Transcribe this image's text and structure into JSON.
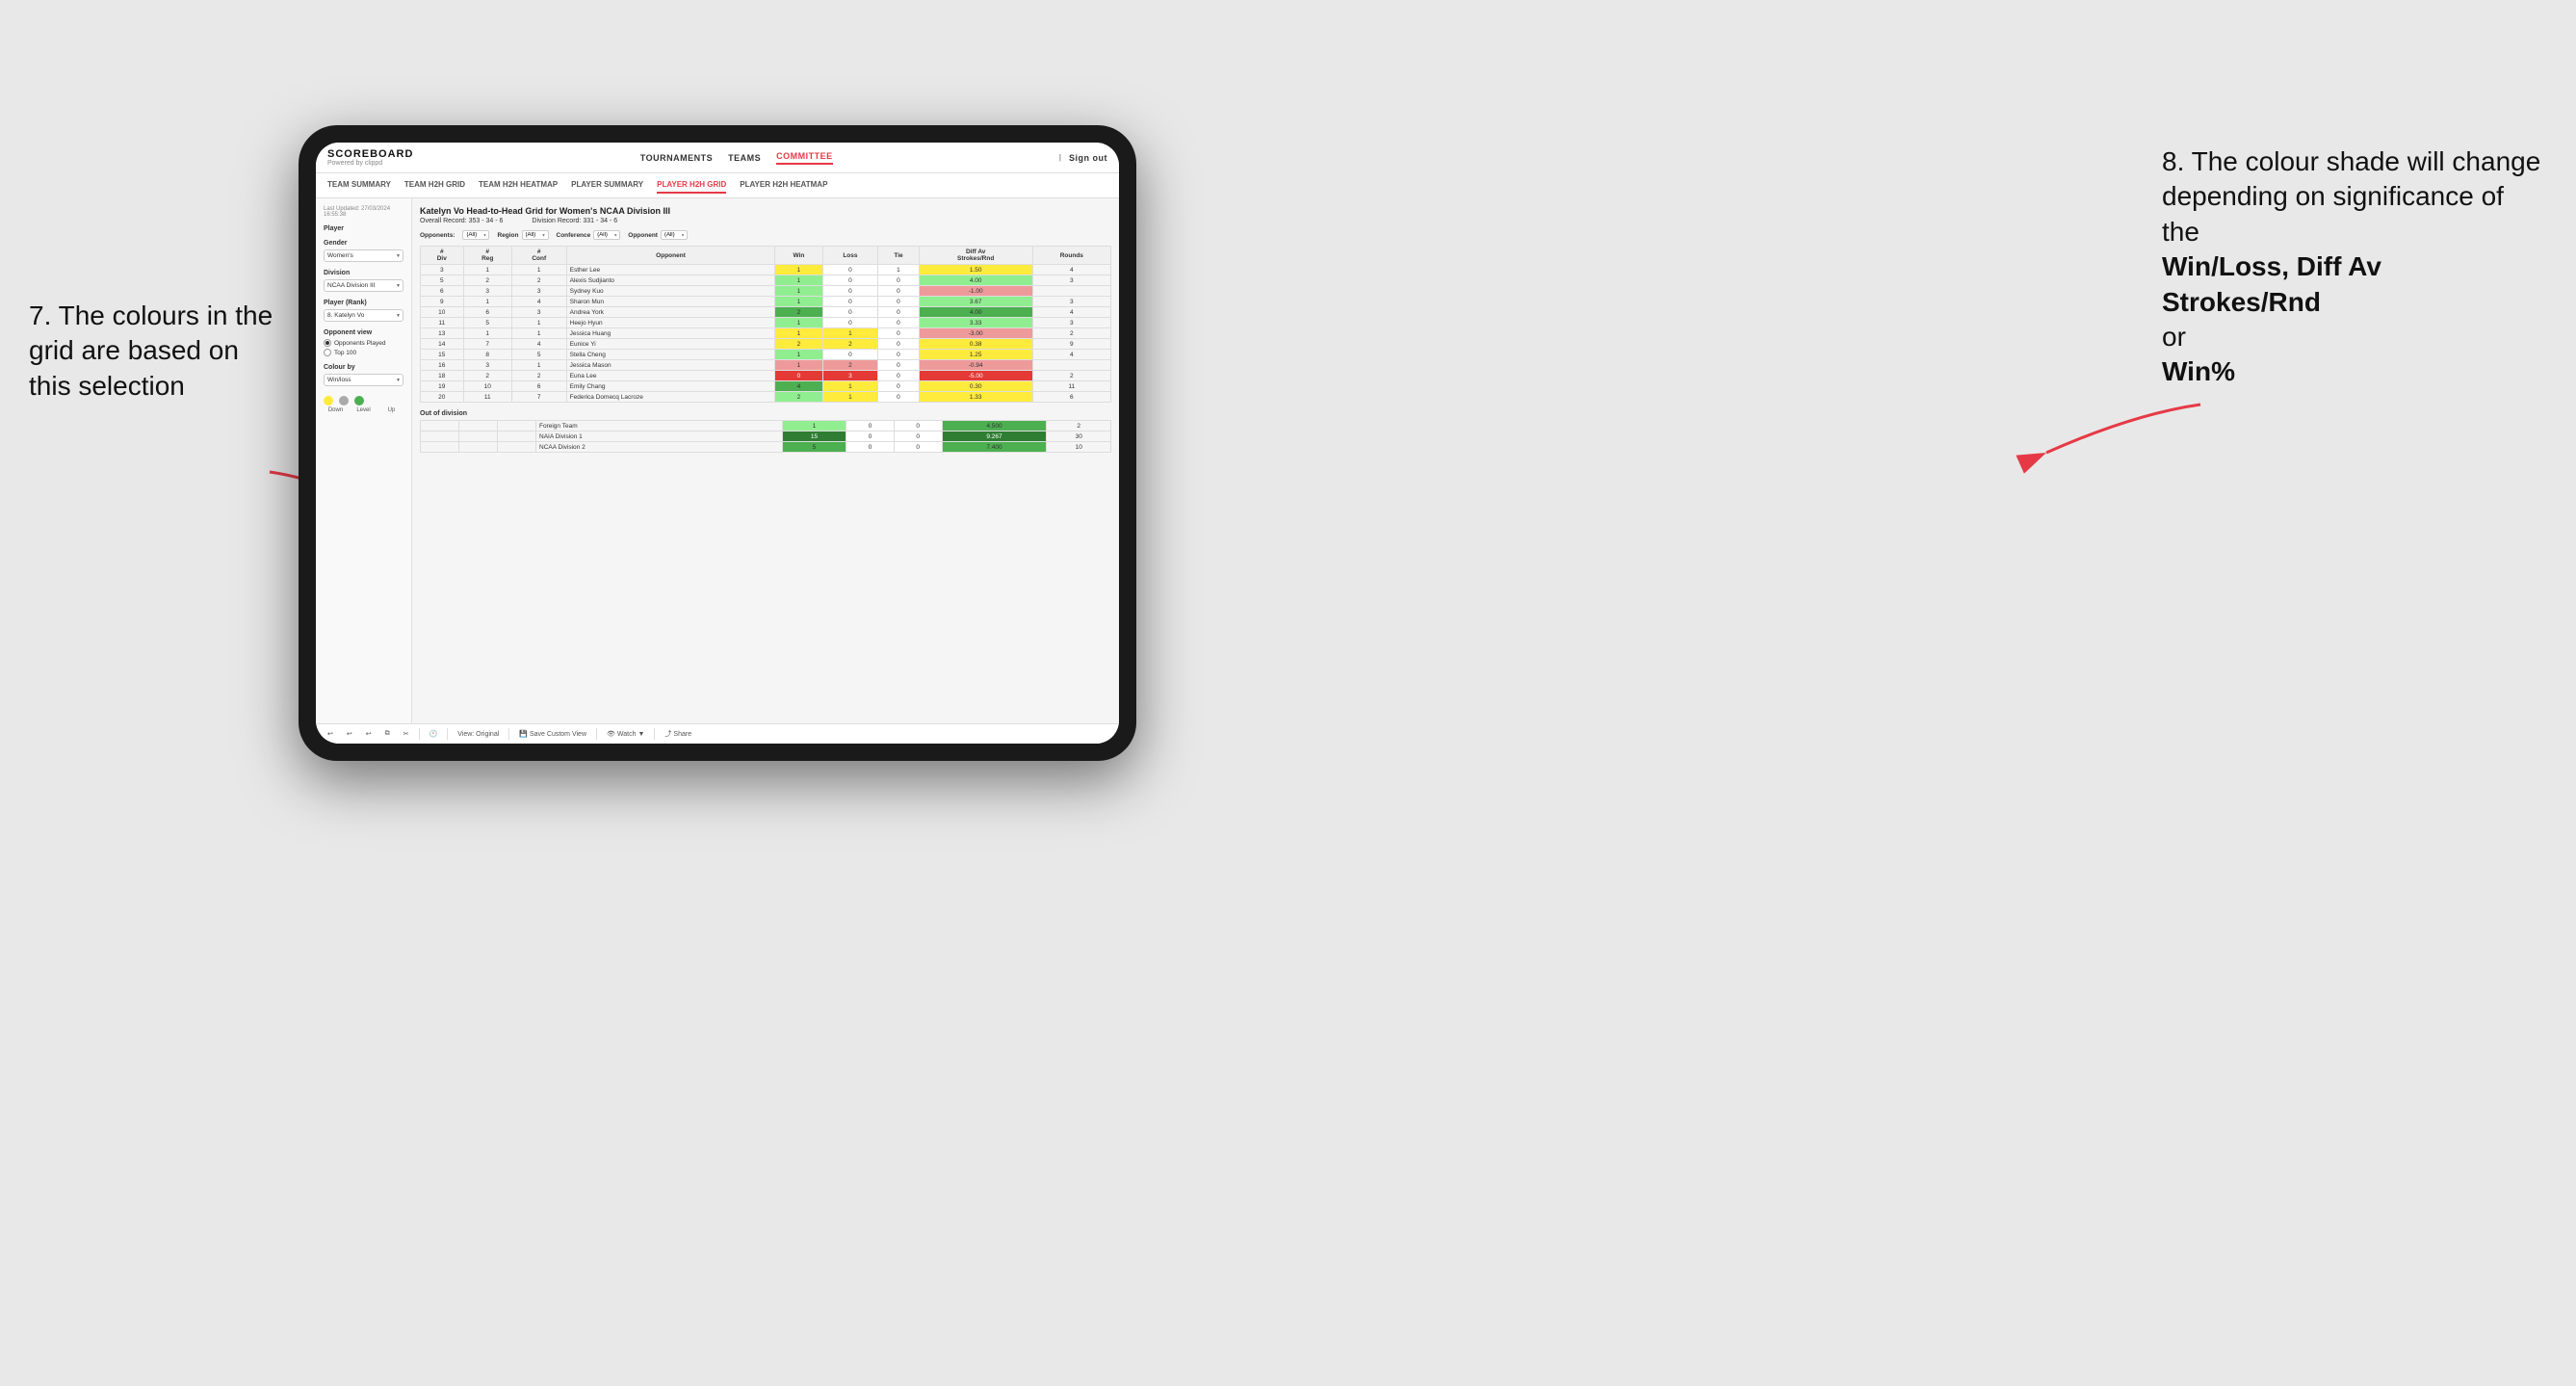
{
  "annotations": {
    "left_title": "7. The colours in the grid are based on this selection",
    "right_title": "8. The colour shade will change depending on significance of the",
    "right_bold1": "Win/Loss,",
    "right_bold2": "Diff Av Strokes/Rnd",
    "right_connector": "or",
    "right_bold3": "Win%"
  },
  "nav": {
    "logo": "SCOREBOARD",
    "logo_sub": "Powered by clippd",
    "links": [
      "TOURNAMENTS",
      "TEAMS",
      "COMMITTEE"
    ],
    "active_link": "COMMITTEE",
    "right": [
      "Sign out"
    ]
  },
  "sub_nav": {
    "links": [
      "TEAM SUMMARY",
      "TEAM H2H GRID",
      "TEAM H2H HEATMAP",
      "PLAYER SUMMARY",
      "PLAYER H2H GRID",
      "PLAYER H2H HEATMAP"
    ],
    "active": "PLAYER H2H GRID"
  },
  "sidebar": {
    "timestamp_label": "Last Updated: 27/03/2024",
    "timestamp_time": "16:55:38",
    "player_label": "Player",
    "gender_label": "Gender",
    "gender_value": "Women's",
    "division_label": "Division",
    "division_value": "NCAA Division III",
    "player_rank_label": "Player (Rank)",
    "player_rank_value": "8. Katelyn Vo",
    "opponent_view_label": "Opponent view",
    "opponent_played_label": "Opponents Played",
    "top100_label": "Top 100",
    "colour_by_label": "Colour by",
    "colour_by_value": "Win/loss",
    "legend_down": "Down",
    "legend_level": "Level",
    "legend_up": "Up"
  },
  "grid": {
    "title": "Katelyn Vo Head-to-Head Grid for Women's NCAA Division III",
    "overall_record_label": "Overall Record:",
    "overall_record_value": "353 - 34 - 6",
    "division_record_label": "Division Record:",
    "division_record_value": "331 - 34 - 6",
    "opponents_label": "Opponents:",
    "opponents_value": "(All)",
    "region_label": "Region",
    "region_value": "(All)",
    "conference_label": "Conference",
    "conference_value": "(All)",
    "opponent_label": "Opponent",
    "opponent_value": "(All)",
    "col_headers": [
      "#\nDiv",
      "#\nReg",
      "#\nConf",
      "Opponent",
      "Win",
      "Loss",
      "Tie",
      "Diff Av\nStrokes/Rnd",
      "Rounds"
    ],
    "rows": [
      {
        "div": "3",
        "reg": "1",
        "conf": "1",
        "opponent": "Esther Lee",
        "win": 1,
        "loss": 0,
        "tie": 1,
        "diff": "1.50",
        "rounds": "4",
        "win_color": "yellow",
        "loss_color": "white",
        "tie_color": "white",
        "diff_color": "yellow"
      },
      {
        "div": "5",
        "reg": "2",
        "conf": "2",
        "opponent": "Alexis Sudjianto",
        "win": 1,
        "loss": 0,
        "tie": 0,
        "diff": "4.00",
        "rounds": "3",
        "win_color": "green-light",
        "loss_color": "white",
        "tie_color": "white",
        "diff_color": "green-light"
      },
      {
        "div": "6",
        "reg": "3",
        "conf": "3",
        "opponent": "Sydney Kuo",
        "win": 1,
        "loss": 0,
        "tie": 0,
        "diff": "-1.00",
        "rounds": "",
        "win_color": "green-light",
        "loss_color": "white",
        "tie_color": "white",
        "diff_color": "red-light"
      },
      {
        "div": "9",
        "reg": "1",
        "conf": "4",
        "opponent": "Sharon Mun",
        "win": 1,
        "loss": 0,
        "tie": 0,
        "diff": "3.67",
        "rounds": "3",
        "win_color": "green-light",
        "loss_color": "white",
        "tie_color": "white",
        "diff_color": "green-light"
      },
      {
        "div": "10",
        "reg": "6",
        "conf": "3",
        "opponent": "Andrea York",
        "win": 2,
        "loss": 0,
        "tie": 0,
        "diff": "4.00",
        "rounds": "4",
        "win_color": "green-mid",
        "loss_color": "white",
        "tie_color": "white",
        "diff_color": "green-mid"
      },
      {
        "div": "11",
        "reg": "5",
        "conf": "1",
        "opponent": "Heejo Hyun",
        "win": 1,
        "loss": 0,
        "tie": 0,
        "diff": "3.33",
        "rounds": "3",
        "win_color": "green-light",
        "loss_color": "white",
        "tie_color": "white",
        "diff_color": "green-light"
      },
      {
        "div": "13",
        "reg": "1",
        "conf": "1",
        "opponent": "Jessica Huang",
        "win": 1,
        "loss": 1,
        "tie": 0,
        "diff": "-3.00",
        "rounds": "2",
        "win_color": "yellow",
        "loss_color": "yellow",
        "tie_color": "white",
        "diff_color": "red-light"
      },
      {
        "div": "14",
        "reg": "7",
        "conf": "4",
        "opponent": "Eunice Yi",
        "win": 2,
        "loss": 2,
        "tie": 0,
        "diff": "0.38",
        "rounds": "9",
        "win_color": "yellow",
        "loss_color": "yellow",
        "tie_color": "white",
        "diff_color": "yellow"
      },
      {
        "div": "15",
        "reg": "8",
        "conf": "5",
        "opponent": "Stella Cheng",
        "win": 1,
        "loss": 0,
        "tie": 0,
        "diff": "1.25",
        "rounds": "4",
        "win_color": "green-light",
        "loss_color": "white",
        "tie_color": "white",
        "diff_color": "yellow"
      },
      {
        "div": "16",
        "reg": "3",
        "conf": "1",
        "opponent": "Jessica Mason",
        "win": 1,
        "loss": 2,
        "tie": 0,
        "diff": "-0.94",
        "rounds": "",
        "win_color": "red-light",
        "loss_color": "red-light",
        "tie_color": "white",
        "diff_color": "red-light"
      },
      {
        "div": "18",
        "reg": "2",
        "conf": "2",
        "opponent": "Euna Lee",
        "win": 0,
        "loss": 3,
        "tie": 0,
        "diff": "-5.00",
        "rounds": "2",
        "win_color": "red",
        "loss_color": "red",
        "tie_color": "white",
        "diff_color": "red"
      },
      {
        "div": "19",
        "reg": "10",
        "conf": "6",
        "opponent": "Emily Chang",
        "win": 4,
        "loss": 1,
        "tie": 0,
        "diff": "0.30",
        "rounds": "11",
        "win_color": "green-mid",
        "loss_color": "yellow",
        "tie_color": "white",
        "diff_color": "yellow"
      },
      {
        "div": "20",
        "reg": "11",
        "conf": "7",
        "opponent": "Federica Domecq Lacroze",
        "win": 2,
        "loss": 1,
        "tie": 0,
        "diff": "1.33",
        "rounds": "6",
        "win_color": "green-light",
        "loss_color": "yellow",
        "tie_color": "white",
        "diff_color": "yellow"
      }
    ],
    "out_of_division_label": "Out of division",
    "out_of_division_rows": [
      {
        "name": "Foreign Team",
        "win": 1,
        "loss": 0,
        "tie": 0,
        "diff": "4.500",
        "rounds": "2",
        "win_color": "green-light",
        "diff_color": "green-mid"
      },
      {
        "name": "NAIA Division 1",
        "win": 15,
        "loss": 0,
        "tie": 0,
        "diff": "9.267",
        "rounds": "30",
        "win_color": "green-dark",
        "diff_color": "green-dark"
      },
      {
        "name": "NCAA Division 2",
        "win": 5,
        "loss": 0,
        "tie": 0,
        "diff": "7.400",
        "rounds": "10",
        "win_color": "green-mid",
        "diff_color": "green-mid"
      }
    ]
  },
  "toolbar": {
    "view_original": "View: Original",
    "save_custom": "Save Custom View",
    "watch": "Watch",
    "share": "Share"
  }
}
